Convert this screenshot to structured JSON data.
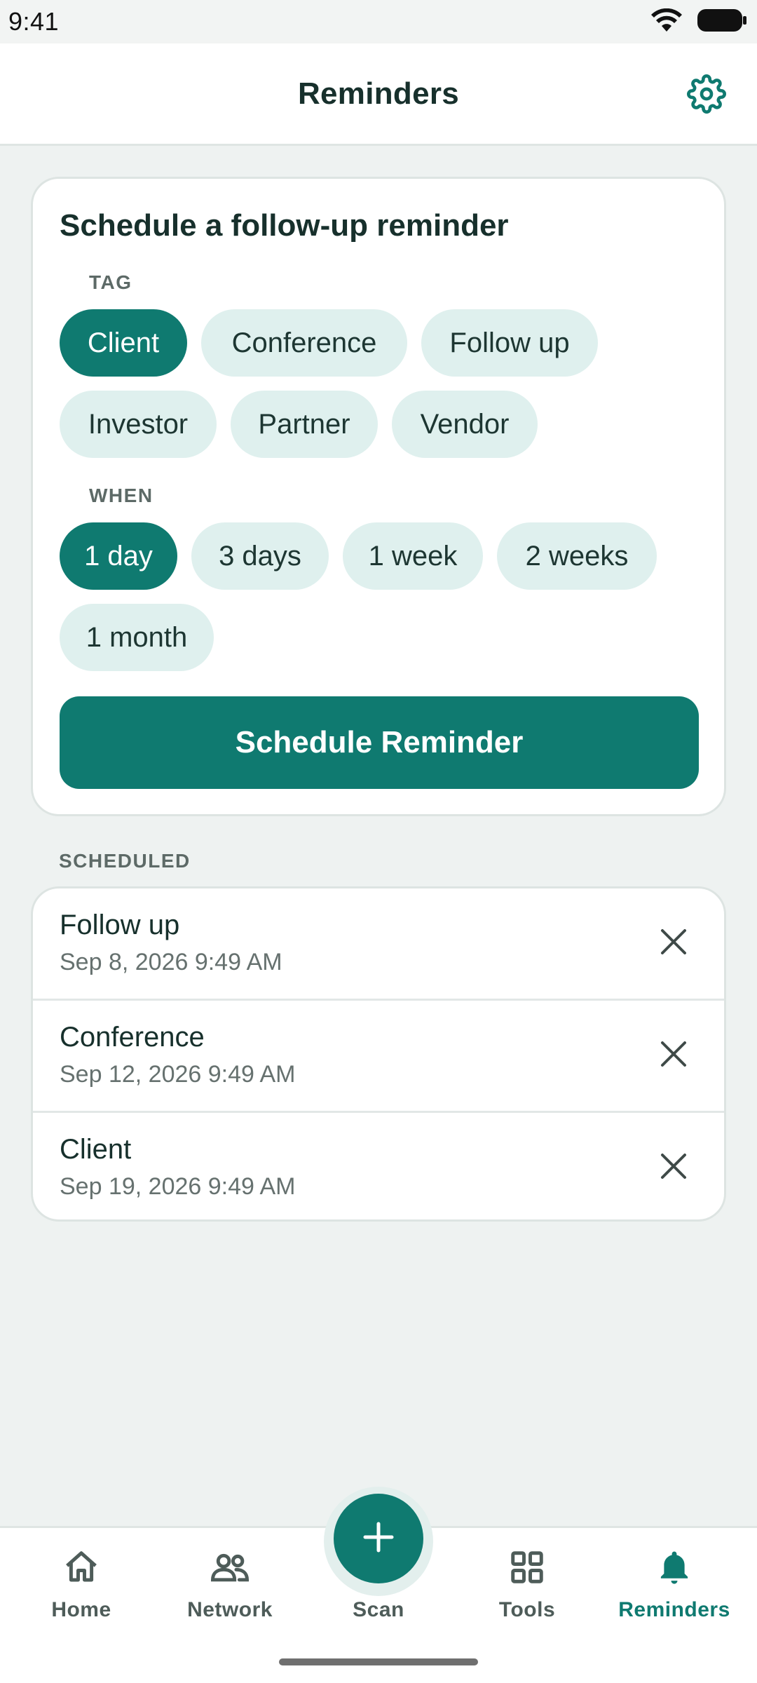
{
  "status_bar": {
    "time": "9:41"
  },
  "app_bar": {
    "title": "Reminders",
    "settings_icon": "gear-icon"
  },
  "schedule_card": {
    "title": "Schedule a follow-up reminder",
    "tag_label": "TAG",
    "tags": [
      "Client",
      "Conference",
      "Follow up",
      "Investor",
      "Partner",
      "Vendor"
    ],
    "selected_tag": "Client",
    "when_label": "WHEN",
    "when_options": [
      "1 day",
      "3 days",
      "1 week",
      "2 weeks",
      "1 month"
    ],
    "selected_when": "1 day",
    "button_label": "Schedule Reminder"
  },
  "scheduled": {
    "label": "SCHEDULED",
    "items": [
      {
        "title": "Follow up",
        "datetime": "Sep 8, 2026 9:49 AM"
      },
      {
        "title": "Conference",
        "datetime": "Sep 12, 2026 9:49 AM"
      },
      {
        "title": "Client",
        "datetime": "Sep 19, 2026 9:49 AM"
      }
    ]
  },
  "bottom_nav": {
    "items": [
      {
        "label": "Home",
        "icon": "home-icon",
        "active": false
      },
      {
        "label": "Network",
        "icon": "people-icon",
        "active": false
      },
      {
        "label": "Scan",
        "icon": "plus-icon",
        "active": false
      },
      {
        "label": "Tools",
        "icon": "grid-icon",
        "active": false
      },
      {
        "label": "Reminders",
        "icon": "bell-icon",
        "active": true
      }
    ]
  },
  "colors": {
    "accent": "#0f7a70",
    "chip_background": "#dff0ee",
    "page_background": "#eef2f1"
  }
}
